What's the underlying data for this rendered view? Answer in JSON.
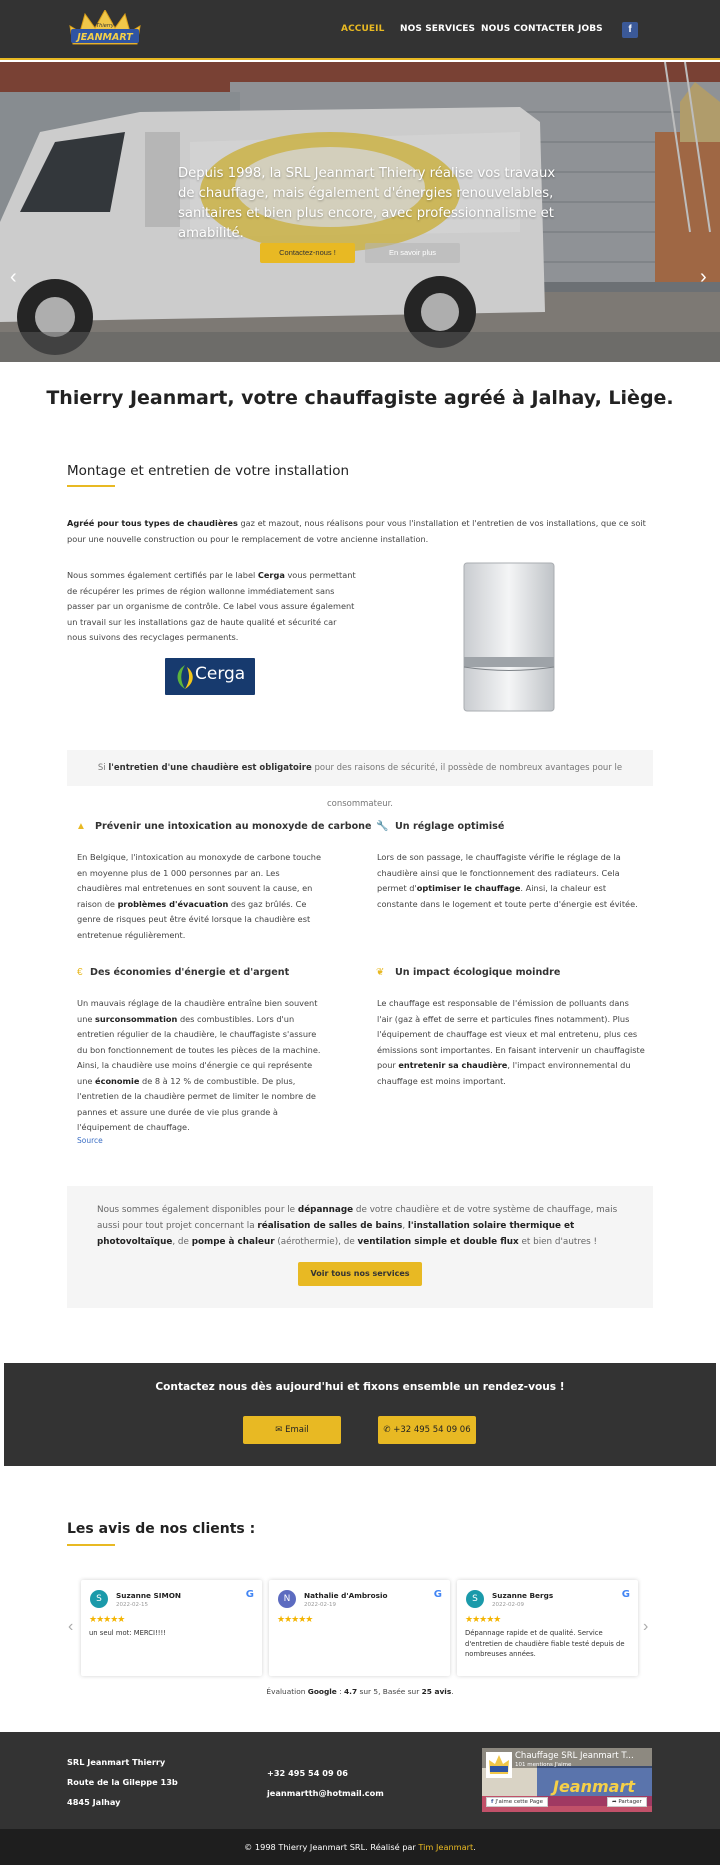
{
  "header": {
    "logo_text": "Thierry JEANMART",
    "nav": [
      "ACCUEIL",
      "NOS SERVICES",
      "NOUS CONTACTER",
      "JOBS"
    ],
    "facebook": "f"
  },
  "hero": {
    "text": "Depuis 1998, la SRL Jeanmart Thierry réalise vos travaux de chauffage, mais également d'énergies renouvelables, sanitaires et bien plus encore, avec professionnalisme et amabilité.",
    "btn_contact": "Contactez-nous !",
    "btn_more": "En savoir plus"
  },
  "main": {
    "title": "Thierry Jeanmart, votre chauffagiste agréé à Jalhay, Liège.",
    "section_title": "Montage et entretien de votre installation",
    "intro_bold": "Agréé pour tous types de chaudières",
    "intro_rest": " gaz et mazout, nous réalisons pour vous l'installation et l'entretien de vos installations, que ce soit pour une nouvelle construction ou pour le remplacement de votre ancienne installation.",
    "cerga_1": "Nous sommes également certifiés par le label ",
    "cerga_bold": "Cerga",
    "cerga_2": " vous permettant de récupérer les primes de région wallonne immédiatement sans passer par un organisme de contrôle. Ce label vous assure également un travail sur les installations gaz de haute qualité et sécurité car nous suivons des recyclages permanents.",
    "cerga_logo": "Cerga",
    "infobar_1": "Si ",
    "infobar_bold": "l'entretien d'une chaudière est obligatoire",
    "infobar_2": " pour des raisons de sécurité, il possède de nombreux avantages pour le consommateur."
  },
  "features": {
    "f1_title": "Prévenir une intoxication au monoxyde de carbone",
    "f1_a": "En Belgique, l'intoxication au monoxyde de carbone touche en moyenne plus de 1 000 personnes par an. Les chaudières mal entretenues en sont souvent la cause, en raison de ",
    "f1_b": "problèmes d'évacuation",
    "f1_c": " des gaz brûlés. Ce genre de risques peut être évité lorsque la chaudière est entretenue régulièrement.",
    "f2_title": "Un réglage optimisé",
    "f2_a": "Lors de son passage, le chauffagiste vérifie le réglage de la chaudière ainsi que le fonctionnement des radiateurs. Cela permet d'",
    "f2_b": "optimiser le chauffage",
    "f2_c": ". Ainsi, la chaleur est constante dans le logement et toute perte d'énergie est évitée.",
    "f3_title": "Des économies d'énergie et d'argent",
    "f3_a": "Un mauvais réglage de la chaudière entraîne bien souvent une ",
    "f3_b": "surconsommation",
    "f3_c": " des combustibles. Lors d'un entretien régulier de la chaudière, le chauffagiste s'assure du bon fonctionnement de toutes les pièces de la machine. Ainsi, la chaudière use moins d'énergie ce qui représente une ",
    "f3_d": "économie",
    "f3_e": " de 8 à 12 % de combustible. De plus, l'entretien de la chaudière permet de limiter le nombre de pannes et assure une durée de vie plus grande à l'équipement de chauffage.",
    "f4_title": "Un impact écologique moindre",
    "f4_a": "Le chauffage est responsable de l'émission de polluants dans l'air (gaz à effet de serre et particules fines notamment). Plus l'équipement de chauffage est vieux et mal entretenu, plus ces émissions sont importantes. En faisant intervenir un chauffagiste pour ",
    "f4_b": "entretenir sa chaudière",
    "f4_c": ", l'impact environnemental du chauffage est moins important.",
    "source": "Source"
  },
  "services": {
    "t1": "Nous sommes également disponibles pour le ",
    "b1": "dépannage",
    "t2": " de votre chaudière et de votre système de chauffage, mais aussi pour tout projet concernant la ",
    "b2": "réalisation de salles de bains",
    "t3": ", ",
    "b3": "l'installation solaire thermique et photovoltaïque",
    "t4": ", de ",
    "b4": "pompe à chaleur",
    "t5": " (aérothermie), de ",
    "b5": "ventilation simple et double flux",
    "t6": " et bien d'autres !",
    "button": "Voir tous nos services"
  },
  "contact": {
    "title": "Contactez nous dès aujourd'hui et fixons ensemble un rendez-vous !",
    "email": "Email",
    "phone": "+32 495 54 09 06"
  },
  "reviews": {
    "title": "Les avis de nos clients :",
    "items": [
      {
        "initial": "S",
        "name": "Suzanne SIMON",
        "date": "2022-02-15",
        "text": "un seul mot: MERCI!!!!",
        "color": "#1b9aaa"
      },
      {
        "initial": "N",
        "name": "Nathalie d'Ambrosio",
        "date": "2022-02-19",
        "text": "",
        "color": "#5c6bc0"
      },
      {
        "initial": "S",
        "name": "Suzanne Bergs",
        "date": "2022-02-09",
        "text": "Dépannage rapide et de qualité. Service d'entretien de chaudière fiable testé depuis de nombreuses années.",
        "color": "#1b9aaa"
      }
    ],
    "stars": "★★★★★",
    "google": "G",
    "rating_1": "Évaluation ",
    "rating_google": "Google",
    "rating_2": " : ",
    "rating_score": "4.7",
    "rating_3": " sur 5, Basée sur ",
    "rating_count": "25 avis",
    "rating_4": "."
  },
  "footer": {
    "company": "SRL Jeanmart Thierry",
    "street": "Route de la Gileppe 13b",
    "city": "4845 Jalhay",
    "phone": "+32 495 54 09 06",
    "email": "jeanmartth@hotmail.com",
    "fb_page": "Chauffage SRL Jeanmart T...",
    "fb_members": "101 mentions J'aime",
    "fb_like": "J'aime cette Page",
    "fb_share": "Partager",
    "copyright_1": "© 1998 Thierry Jeanmart SRL. Réalisé par ",
    "copyright_link": "Tim Jeanmart",
    "copyright_2": "."
  },
  "colors": {
    "accent": "#e8b923",
    "dark": "#333333",
    "facebook": "#3b5998"
  }
}
